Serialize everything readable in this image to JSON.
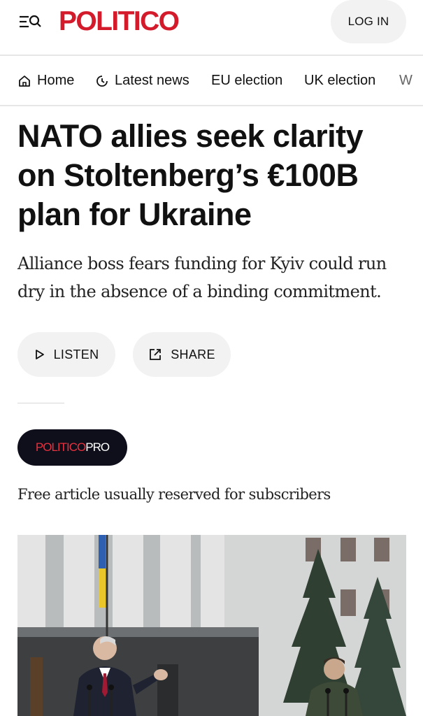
{
  "header": {
    "logo": "POLITICO",
    "login_label": "LOG IN",
    "menu_icon": "menu-search-icon"
  },
  "nav": {
    "items": [
      {
        "label": "Home",
        "icon": "home-icon"
      },
      {
        "label": "Latest news",
        "icon": "clock-icon"
      },
      {
        "label": "EU election"
      },
      {
        "label": "UK election"
      },
      {
        "label": "W"
      }
    ]
  },
  "article": {
    "headline": "NATO allies seek clarity on Stoltenberg’s €100B plan for Ukraine",
    "dek": "Alliance boss fears funding for Kyiv could run dry in the absence of a binding commitment.",
    "listen_label": "LISTEN",
    "share_label": "SHARE",
    "badge_part1": "POLITICO",
    "badge_part2": "PRO",
    "free_note": "Free article usually reserved for subscribers"
  },
  "colors": {
    "brand_red": "#d41b2c",
    "badge_bg": "#0e0f1a",
    "pill_bg": "#f2f2f2"
  }
}
